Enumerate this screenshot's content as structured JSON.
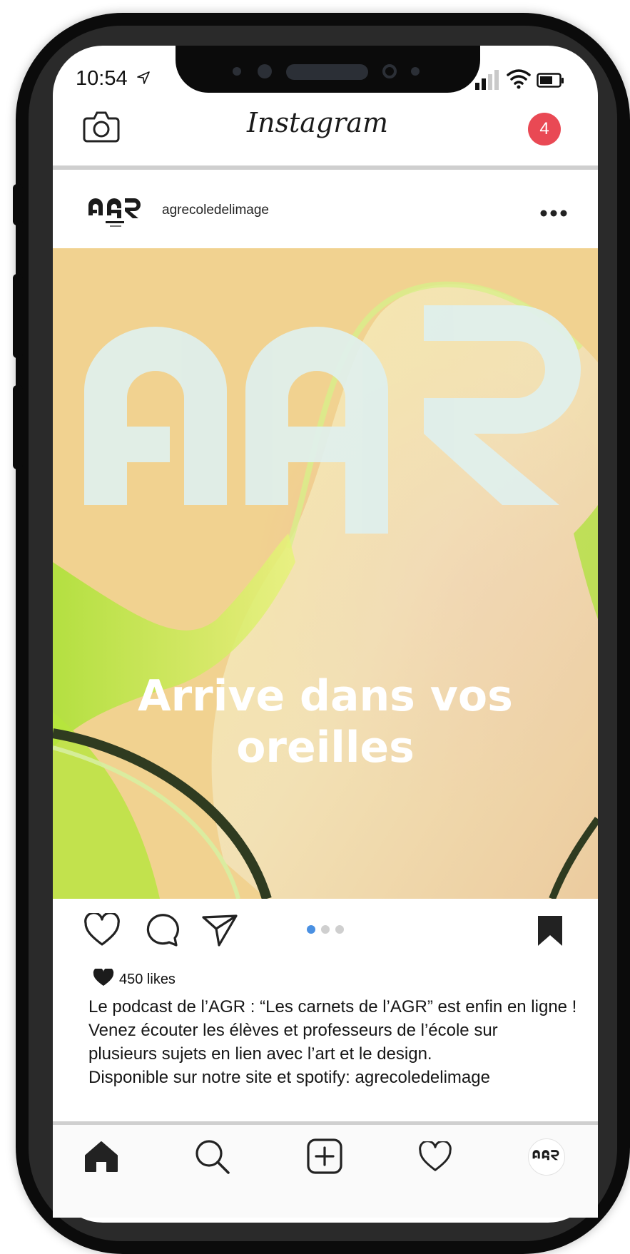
{
  "status_bar": {
    "time": "10:54"
  },
  "header": {
    "app_title": "Instagram",
    "notification_count": "4"
  },
  "post": {
    "username": "agrecoledelimage",
    "image_headline_line1": "Arrive dans vos",
    "image_headline_line2": "oreilles",
    "likes": "450 likes",
    "caption_lines": [
      "Le podcast de l’AGR : “Les carnets de l’AGR” est enfin en ligne !",
      "Venez écouter les élèves et professeurs de l’école sur",
      "plusieurs sujets en lien avec l’art et le design.",
      "Disponible sur notre site et spotify: agrecoledelimage"
    ],
    "carousel_dots": 3,
    "carousel_active": 1
  },
  "colors": {
    "badge": "#e94954",
    "active_dot": "#4a90e2",
    "inactive_dot": "#cfcfcf",
    "image_background": "#f2d28e"
  },
  "icons": {
    "header": [
      "camera-icon"
    ],
    "actions": [
      "heart-icon",
      "comment-icon",
      "share-icon",
      "bookmark-icon"
    ],
    "tabs": [
      "home-icon",
      "search-icon",
      "add-icon",
      "activity-heart-icon",
      "profile-avatar"
    ]
  }
}
